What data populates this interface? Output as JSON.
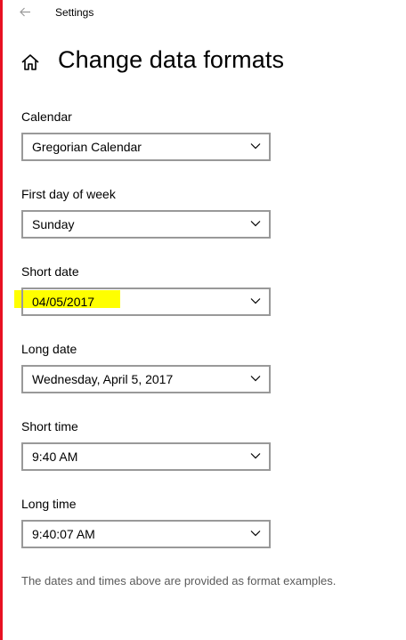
{
  "window": {
    "title": "Settings",
    "back_icon": "arrow-left-icon"
  },
  "header": {
    "home_icon": "home-icon",
    "title": "Change data formats"
  },
  "fields": {
    "calendar": {
      "label": "Calendar",
      "value": "Gregorian Calendar"
    },
    "first_day": {
      "label": "First day of week",
      "value": "Sunday"
    },
    "short_date": {
      "label": "Short date",
      "value": "04/05/2017",
      "highlight_color": "#ffff00"
    },
    "long_date": {
      "label": "Long date",
      "value": "Wednesday, April 5, 2017"
    },
    "short_time": {
      "label": "Short time",
      "value": "9:40 AM"
    },
    "long_time": {
      "label": "Long time",
      "value": "9:40:07 AM"
    }
  },
  "footnote": "The dates and times above are provided as format examples.",
  "colors": {
    "accent_edge": "#e81123",
    "dropdown_border": "#999999",
    "footnote_text": "#5a5a5a"
  }
}
